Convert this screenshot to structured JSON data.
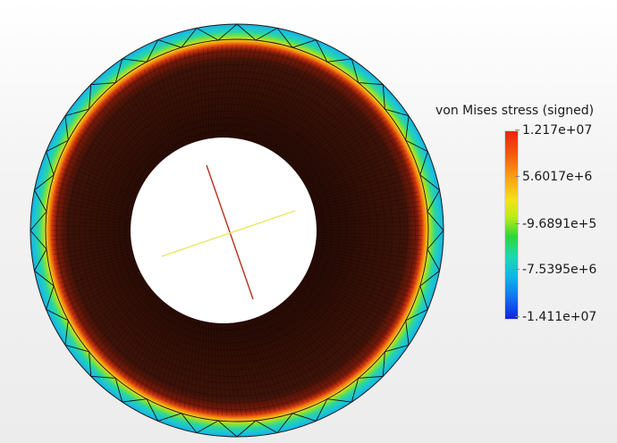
{
  "legend": {
    "title": "von Mises stress (signed)",
    "ticks": [
      "1.217e+07",
      "5.6017e+6",
      "-9.6891e+5",
      "-7.5395e+6",
      "-1.411e+07"
    ],
    "range": [
      -14110000,
      12170000
    ]
  },
  "colors": {
    "background": "#f0f0f0",
    "stress_high": "#e8250f",
    "stress_mid": "#f3e21c",
    "stress_low": "#1322e2",
    "outer_ring": "#1ec7c4",
    "inner_surface": "#3a1008",
    "axis_red": "#b8301c",
    "axis_yellow": "#e8e85c"
  }
}
